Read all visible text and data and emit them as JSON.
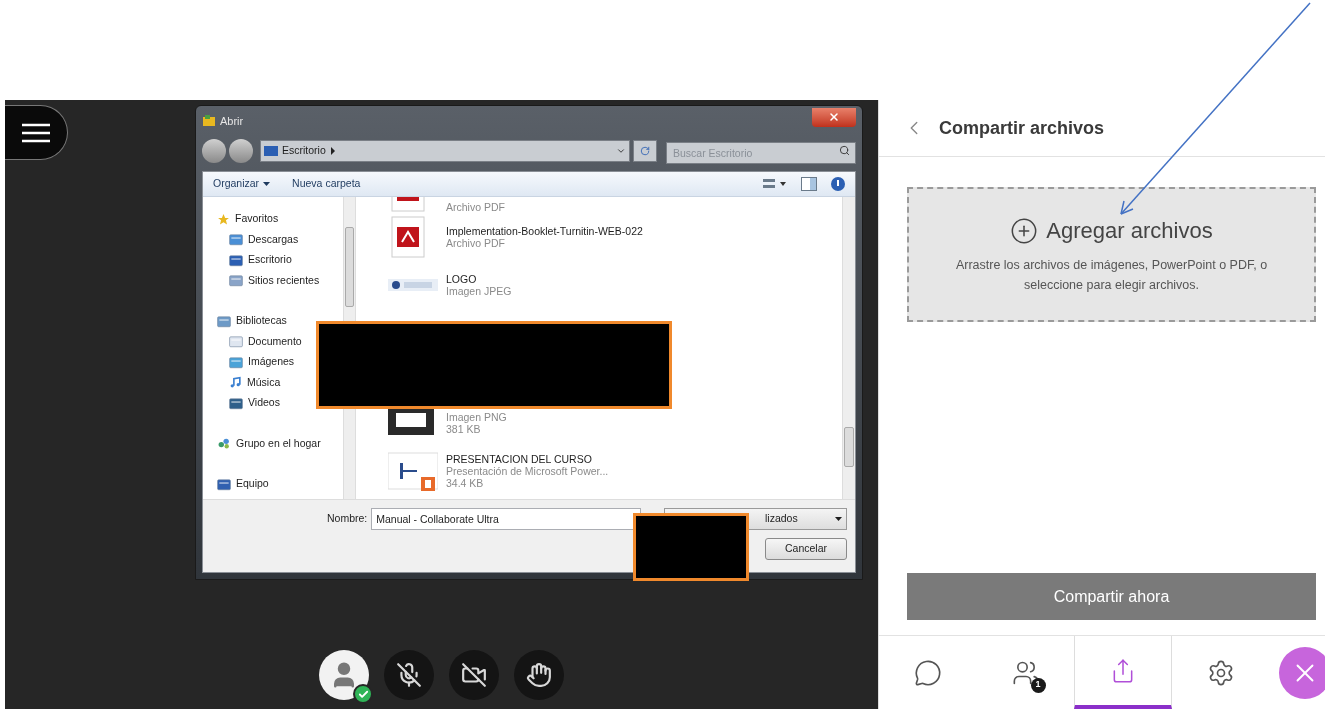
{
  "file_dialog": {
    "title": "Abrir",
    "address": "Escritorio",
    "search": {
      "placeholder": "Buscar Escritorio"
    },
    "toolbar": [
      {
        "label": "Organizar",
        "kind": "menu"
      },
      {
        "label": "Nueva carpeta",
        "kind": "button"
      }
    ],
    "nav": [
      {
        "label": "Favoritos",
        "kind": "star",
        "children": [
          {
            "label": "Descargas",
            "kind": "download"
          },
          {
            "label": "Escritorio",
            "kind": "desktop"
          },
          {
            "label": "Sitios recientes",
            "kind": "recent"
          }
        ]
      },
      {
        "label": "Bibliotecas",
        "kind": "library",
        "children": [
          {
            "label": "Documento",
            "kind": "document"
          },
          {
            "label": "Imágenes",
            "kind": "images"
          },
          {
            "label": "Música",
            "kind": "music"
          },
          {
            "label": "Videos",
            "kind": "video"
          }
        ]
      },
      {
        "label": "Grupo en el hogar",
        "kind": "homegroup"
      },
      {
        "label": "Equipo",
        "kind": "computer"
      }
    ],
    "files": [
      {
        "kind": "pdf",
        "type": "Archivo PDF"
      },
      {
        "kind": "pdf",
        "name": "Implementation-Booklet-Turnitin-WEB-022",
        "type": "Archivo PDF"
      },
      {
        "kind": "jpeg",
        "name": "LOGO",
        "type": "Imagen JPEG"
      },
      {
        "kind": "redacted"
      },
      {
        "kind": "png",
        "type": "Imagen PNG",
        "size": "381 KB"
      },
      {
        "kind": "pptx",
        "name": "PRESENTACION DEL CURSO",
        "type": "Presentación de Microsoft Power...",
        "size": "34.4 KB"
      }
    ],
    "filename_label": "Nombre:",
    "filename": "Manual - Collaborate Ultra",
    "file_type": "lizados",
    "cancel": "Cancelar"
  },
  "media_controls": [
    {
      "kind": "avatar"
    },
    {
      "kind": "mic-off"
    },
    {
      "kind": "camera-off"
    },
    {
      "kind": "hand"
    }
  ],
  "panel": {
    "title": "Compartir archivos",
    "add_files": "Agregar archivos",
    "hint": "Arrastre los archivos de imágenes, PowerPoint o PDF, o seleccione para elegir archivos.",
    "share_button": "Compartir ahora",
    "tabs": [
      {
        "kind": "chat",
        "selected": false
      },
      {
        "kind": "people",
        "badge": "1",
        "selected": false
      },
      {
        "kind": "share",
        "selected": true
      },
      {
        "kind": "settings",
        "selected": false
      },
      {
        "kind": "close",
        "selected": false
      }
    ]
  }
}
